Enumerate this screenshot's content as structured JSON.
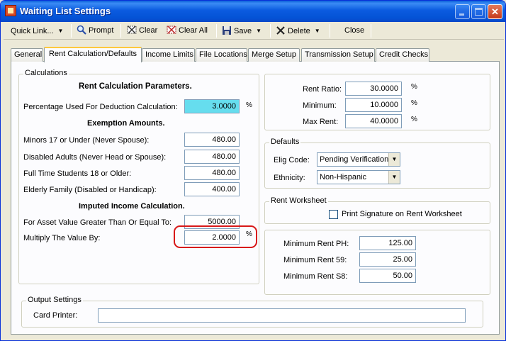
{
  "window": {
    "title": "Waiting List Settings"
  },
  "toolbar": {
    "quick_link": "Quick Link...",
    "prompt": "Prompt",
    "clear": "Clear",
    "clear_all": "Clear All",
    "save": "Save",
    "delete": "Delete",
    "close": "Close"
  },
  "tabs": [
    "General",
    "Rent Calculation/Defaults",
    "Income Limits",
    "File Locations",
    "Merge Setup",
    "Transmission Setup",
    "Credit Checks"
  ],
  "calculations": {
    "legend": "Calculations",
    "rent_params_header": "Rent Calculation Parameters.",
    "pct_deduction_label": "Percentage Used For Deduction Calculation:",
    "pct_deduction_value": "3.0000",
    "exemption_header": "Exemption Amounts.",
    "minors_label": "Minors 17 or Under (Never Spouse):",
    "minors_value": "480.00",
    "disabled_label": "Disabled Adults (Never Head or Spouse):",
    "disabled_value": "480.00",
    "students_label": "Full Time Students 18 or Older:",
    "students_value": "480.00",
    "elderly_label": "Elderly Family (Disabled or Handicap):",
    "elderly_value": "400.00",
    "imputed_header": "Imputed Income Calculation.",
    "asset_label": "For Asset Value Greater Than Or Equal To:",
    "asset_value": "5000.00",
    "multiply_label": "Multiply The Value By:",
    "multiply_value": "2.0000",
    "pct_symbol": "%"
  },
  "ratio": {
    "rent_ratio_label": "Rent Ratio:",
    "rent_ratio_value": "30.0000",
    "minimum_label": "Minimum:",
    "minimum_value": "10.0000",
    "max_rent_label": "Max Rent:",
    "max_rent_value": "40.0000"
  },
  "defaults": {
    "legend": "Defaults",
    "elig_label": "Elig Code:",
    "elig_value": "Pending Verification",
    "ethnicity_label": "Ethnicity:",
    "ethnicity_value": "Non-Hispanic"
  },
  "worksheet": {
    "legend": "Rent Worksheet",
    "print_sig_label": "Print Signature on Rent Worksheet"
  },
  "min_rents": {
    "ph_label": "Minimum Rent PH:",
    "ph_value": "125.00",
    "r59_label": "Minimum Rent 59:",
    "r59_value": "25.00",
    "s8_label": "Minimum Rent S8:",
    "s8_value": "50.00"
  },
  "output": {
    "legend": "Output Settings",
    "card_printer_label": "Card Printer:",
    "card_printer_value": ""
  }
}
